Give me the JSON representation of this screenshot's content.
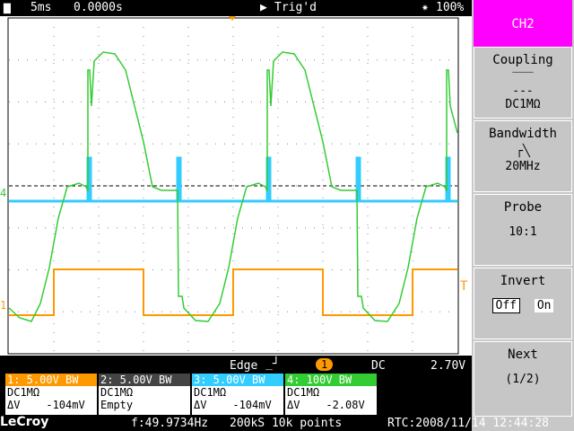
{
  "topbar": {
    "timebase": "5ms",
    "delay": "0.0000s",
    "trigger_state": "Trig'd",
    "zoom": "100%"
  },
  "colors": {
    "ch1": "#ff9900",
    "ch2": "#ffffff",
    "ch3": "#33ccff",
    "ch4": "#33cc33",
    "menu_active": "#ff00ff"
  },
  "markers": {
    "ch1_left": "1",
    "ch4_left": "4",
    "trigger_right": "T"
  },
  "softkeys": {
    "active_channel": "CH2",
    "coupling_label": "Coupling",
    "coupling_value": "DC1MΩ",
    "bandwidth_label": "Bandwidth",
    "bandwidth_value": "20MHz",
    "probe_label": "Probe",
    "probe_value": "10:1",
    "invert_label": "Invert",
    "invert_off": "Off",
    "invert_on": "On",
    "next_label": "Next",
    "next_page": "(1/2)"
  },
  "trigger": {
    "type": "Edge",
    "source": "1",
    "coupling": "DC",
    "level": "2.70V"
  },
  "channels": [
    {
      "head": "1: 5.00V  BW",
      "line1": "DC1MΩ",
      "line2": "ΔV    -104mV",
      "color": "#ff9900"
    },
    {
      "head": "2: 5.00V  BW",
      "line1": "DC1MΩ",
      "line2": "Empty",
      "color": "#ffffff"
    },
    {
      "head": "3: 5.00V  BW",
      "line1": "DC1MΩ",
      "line2": "ΔV    -104mV",
      "color": "#33ccff"
    },
    {
      "head": "4:  100V  BW",
      "line1": "DC1MΩ",
      "line2": "ΔV    -2.08V",
      "color": "#33cc33"
    }
  ],
  "footer": {
    "brand": "LeCroy",
    "frequency": "f:49.9734Hz",
    "sampling": "200kS  10k points",
    "rtc": "RTC:2008/11/14  12:44:28"
  }
}
